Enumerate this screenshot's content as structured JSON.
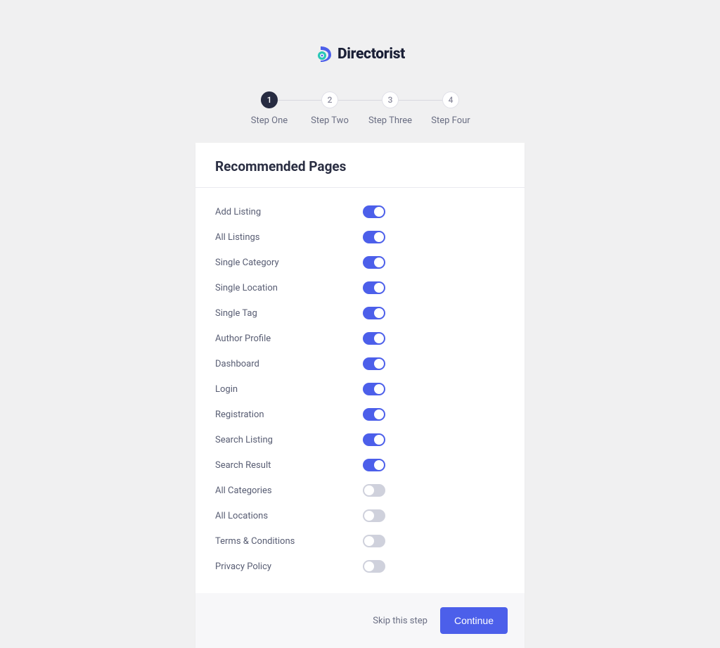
{
  "brand": "Directorist",
  "steps": [
    {
      "num": "1",
      "label": "Step One",
      "active": true
    },
    {
      "num": "2",
      "label": "Step Two",
      "active": false
    },
    {
      "num": "3",
      "label": "Step Three",
      "active": false
    },
    {
      "num": "4",
      "label": "Step Four",
      "active": false
    }
  ],
  "card": {
    "title": "Recommended Pages",
    "items": [
      {
        "label": "Add Listing",
        "on": true
      },
      {
        "label": "All Listings",
        "on": true
      },
      {
        "label": "Single Category",
        "on": true
      },
      {
        "label": "Single Location",
        "on": true
      },
      {
        "label": "Single Tag",
        "on": true
      },
      {
        "label": "Author Profile",
        "on": true
      },
      {
        "label": "Dashboard",
        "on": true
      },
      {
        "label": "Login",
        "on": true
      },
      {
        "label": "Registration",
        "on": true
      },
      {
        "label": "Search Listing",
        "on": true
      },
      {
        "label": "Search Result",
        "on": true
      },
      {
        "label": "All Categories",
        "on": false
      },
      {
        "label": "All Locations",
        "on": false
      },
      {
        "label": "Terms & Conditions",
        "on": false
      },
      {
        "label": "Privacy Policy",
        "on": false
      }
    ]
  },
  "footer": {
    "skip": "Skip this step",
    "continue": "Continue"
  }
}
